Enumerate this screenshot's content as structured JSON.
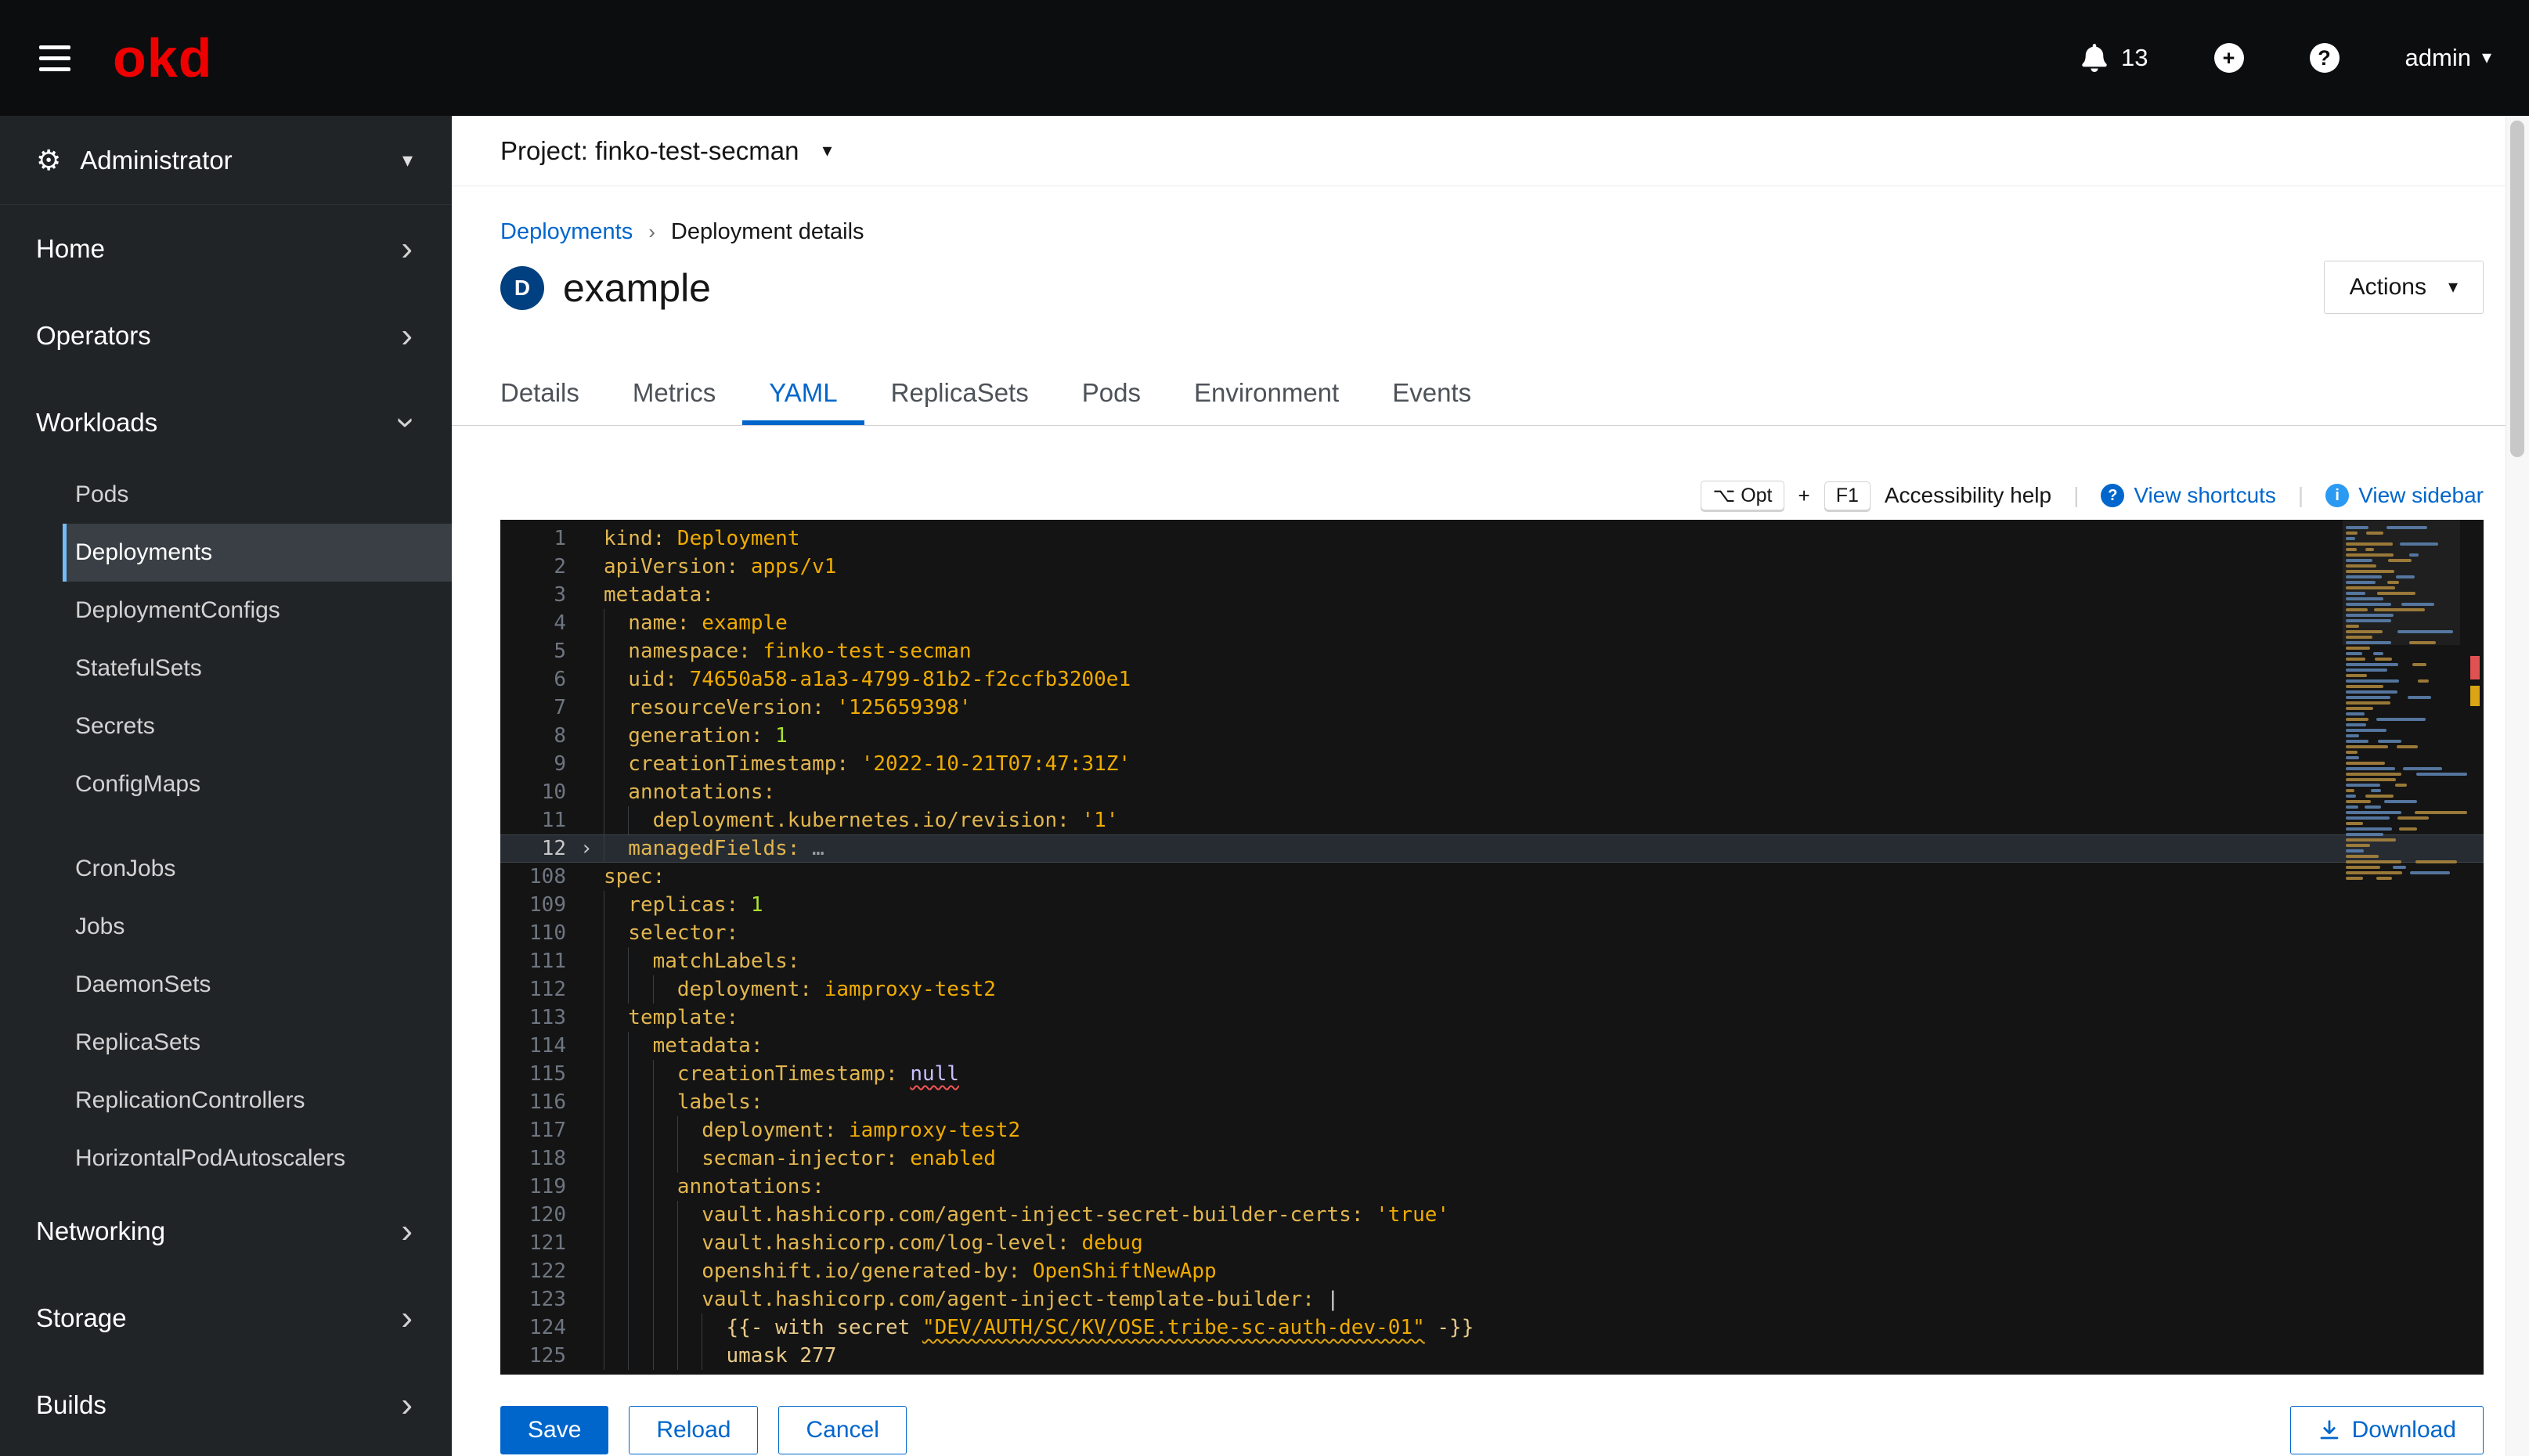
{
  "topbar": {
    "brand": "okd",
    "notification_count": "13",
    "user": "admin"
  },
  "icons": {
    "chevron_right": "›",
    "caret_down": "▾",
    "gear": "⚙",
    "breadcrumb_sep": "›",
    "divider": "|",
    "fold_collapsed": "›",
    "question_glyph": "?",
    "info_glyph": "i",
    "badge_glyph": "D"
  },
  "sidebar": {
    "perspective": "Administrator",
    "nav": [
      {
        "label": "Home",
        "expanded": false
      },
      {
        "label": "Operators",
        "expanded": false
      },
      {
        "label": "Workloads",
        "expanded": true,
        "children": [
          {
            "label": "Pods"
          },
          {
            "label": "Deployments",
            "selected": true
          },
          {
            "label": "DeploymentConfigs"
          },
          {
            "label": "StatefulSets"
          },
          {
            "label": "Secrets"
          },
          {
            "label": "ConfigMaps",
            "group_end": true
          },
          {
            "label": "CronJobs"
          },
          {
            "label": "Jobs"
          },
          {
            "label": "DaemonSets"
          },
          {
            "label": "ReplicaSets"
          },
          {
            "label": "ReplicationControllers"
          },
          {
            "label": "HorizontalPodAutoscalers"
          }
        ]
      },
      {
        "label": "Networking",
        "expanded": false
      },
      {
        "label": "Storage",
        "expanded": false
      },
      {
        "label": "Builds",
        "expanded": false
      }
    ]
  },
  "project_bar": {
    "label": "Project: finko-test-secman"
  },
  "breadcrumb": {
    "link": "Deployments",
    "current": "Deployment details"
  },
  "page_header": {
    "badge": "D",
    "title": "example",
    "actions_label": "Actions"
  },
  "tabs": [
    "Details",
    "Metrics",
    "YAML",
    "ReplicaSets",
    "Pods",
    "Environment",
    "Events"
  ],
  "active_tab": "YAML",
  "editor_toolbar": {
    "kbd1": "⌥ Opt",
    "plus": "+",
    "kbd2": "F1",
    "accessibility": "Accessibility help",
    "view_shortcuts": "View shortcuts",
    "view_sidebar": "View sidebar"
  },
  "editor": {
    "lines": [
      {
        "n": "1",
        "i": 0,
        "t": [
          [
            "k",
            "kind:"
          ],
          [
            "v",
            " Deployment"
          ]
        ]
      },
      {
        "n": "2",
        "i": 0,
        "t": [
          [
            "k",
            "apiVersion:"
          ],
          [
            "v",
            " apps/v1"
          ]
        ]
      },
      {
        "n": "3",
        "i": 0,
        "t": [
          [
            "k",
            "metadata:"
          ]
        ]
      },
      {
        "n": "4",
        "i": 2,
        "t": [
          [
            "k",
            "name:"
          ],
          [
            "v",
            " example"
          ]
        ]
      },
      {
        "n": "5",
        "i": 2,
        "t": [
          [
            "k",
            "namespace:"
          ],
          [
            "v",
            " finko-test-secman"
          ]
        ]
      },
      {
        "n": "6",
        "i": 2,
        "t": [
          [
            "k",
            "uid:"
          ],
          [
            "v",
            " 74650a58-a1a3-4799-81b2-f2ccfb3200e1"
          ]
        ]
      },
      {
        "n": "7",
        "i": 2,
        "t": [
          [
            "k",
            "resourceVersion:"
          ],
          [
            "s",
            " '125659398'"
          ]
        ]
      },
      {
        "n": "8",
        "i": 2,
        "t": [
          [
            "k",
            "generation:"
          ],
          [
            "n",
            " 1"
          ]
        ]
      },
      {
        "n": "9",
        "i": 2,
        "t": [
          [
            "k",
            "creationTimestamp:"
          ],
          [
            "s",
            " '2022-10-21T07:47:31Z'"
          ]
        ]
      },
      {
        "n": "10",
        "i": 2,
        "t": [
          [
            "k",
            "annotations:"
          ]
        ]
      },
      {
        "n": "11",
        "i": 4,
        "t": [
          [
            "k",
            "deployment.kubernetes.io/revision:"
          ],
          [
            "s",
            " '1'"
          ]
        ]
      },
      {
        "n": "12",
        "i": 2,
        "fold": true,
        "sel": true,
        "t": [
          [
            "k",
            "managedFields:"
          ],
          [
            "dots",
            " …"
          ]
        ]
      },
      {
        "n": "108",
        "i": 0,
        "t": [
          [
            "k",
            "spec:"
          ]
        ]
      },
      {
        "n": "109",
        "i": 2,
        "t": [
          [
            "k",
            "replicas:"
          ],
          [
            "n",
            " 1"
          ]
        ]
      },
      {
        "n": "110",
        "i": 2,
        "t": [
          [
            "k",
            "selector:"
          ]
        ]
      },
      {
        "n": "111",
        "i": 4,
        "t": [
          [
            "k",
            "matchLabels:"
          ]
        ]
      },
      {
        "n": "112",
        "i": 6,
        "t": [
          [
            "k",
            "deployment:"
          ],
          [
            "v",
            " iamproxy-test2"
          ]
        ]
      },
      {
        "n": "113",
        "i": 2,
        "t": [
          [
            "k",
            "template:"
          ]
        ]
      },
      {
        "n": "114",
        "i": 4,
        "t": [
          [
            "k",
            "metadata:"
          ]
        ]
      },
      {
        "n": "115",
        "i": 6,
        "t": [
          [
            "k",
            "creationTimestamp:"
          ],
          [
            "p",
            " "
          ],
          [
            "kw err",
            "null"
          ]
        ]
      },
      {
        "n": "116",
        "i": 6,
        "t": [
          [
            "k",
            "labels:"
          ]
        ]
      },
      {
        "n": "117",
        "i": 8,
        "t": [
          [
            "k",
            "deployment:"
          ],
          [
            "v",
            " iamproxy-test2"
          ]
        ]
      },
      {
        "n": "118",
        "i": 8,
        "t": [
          [
            "k",
            "secman-injector:"
          ],
          [
            "v",
            " enabled"
          ]
        ]
      },
      {
        "n": "119",
        "i": 6,
        "t": [
          [
            "k",
            "annotations:"
          ]
        ]
      },
      {
        "n": "120",
        "i": 8,
        "t": [
          [
            "k",
            "vault.hashicorp.com/agent-inject-secret-builder-certs:"
          ],
          [
            "s",
            " 'true'"
          ]
        ]
      },
      {
        "n": "121",
        "i": 8,
        "t": [
          [
            "k",
            "vault.hashicorp.com/log-level:"
          ],
          [
            "v",
            " debug"
          ]
        ]
      },
      {
        "n": "122",
        "i": 8,
        "t": [
          [
            "k",
            "openshift.io/generated-by:"
          ],
          [
            "v",
            " OpenShiftNewApp"
          ]
        ]
      },
      {
        "n": "123",
        "i": 8,
        "t": [
          [
            "k",
            "vault.hashicorp.com/agent-inject-template-builder:"
          ],
          [
            "p",
            " |"
          ]
        ]
      },
      {
        "n": "124",
        "i": 10,
        "t": [
          [
            "b",
            "{{- with secret "
          ],
          [
            "s warn",
            "\"DEV/AUTH/SC/KV/OSE.tribe-sc-auth-dev-01\""
          ],
          [
            "b",
            " -}}"
          ]
        ]
      },
      {
        "n": "125",
        "i": 10,
        "t": [
          [
            "b",
            "umask 277"
          ]
        ]
      }
    ]
  },
  "footer": {
    "save": "Save",
    "reload": "Reload",
    "cancel": "Cancel",
    "download": "Download"
  }
}
